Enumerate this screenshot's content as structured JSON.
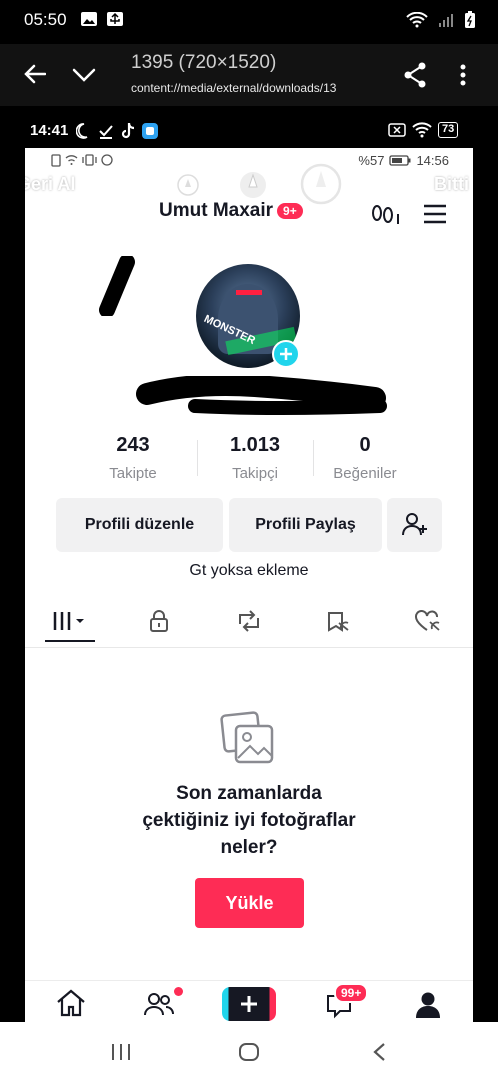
{
  "os_status": {
    "time": "05:50"
  },
  "viewer": {
    "title": "1395 (720×1520)",
    "subtitle": "content://media/external/downloads/13"
  },
  "inner_status": {
    "time": "14:41",
    "battery": "73"
  },
  "tiktok_status": {
    "battery_text": "%57",
    "time": "14:56"
  },
  "overlay": {
    "back_label": "Geri Al",
    "done_label": "Bitti"
  },
  "profile": {
    "username": "Umut Maxair",
    "notif_badge": "9+",
    "avatar_text": "MONSTER",
    "stats": [
      {
        "value": "243",
        "label": "Takipte"
      },
      {
        "value": "1.013",
        "label": "Takipçi"
      },
      {
        "value": "0",
        "label": "Beğeniler"
      }
    ],
    "edit_button": "Profili düzenle",
    "share_button": "Profili Paylaş",
    "bio": "Gt yoksa ekleme"
  },
  "empty_state": {
    "message": "Son zamanlarda çektiğiniz iyi fotoğraflar neler?",
    "upload_button": "Yükle"
  },
  "bottom_nav": {
    "inbox_badge": "99+"
  },
  "colors": {
    "accent": "#fe2c55",
    "plus": "#20d5ec"
  }
}
